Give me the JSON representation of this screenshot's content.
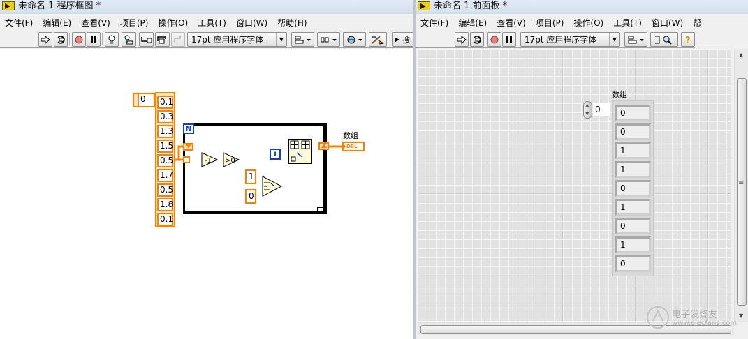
{
  "block_diagram": {
    "title": "未命名 1 程序框图 *",
    "menu": [
      "文件(F)",
      "编辑(E)",
      "查看(V)",
      "项目(P)",
      "操作(O)",
      "工具(T)",
      "窗口(W)",
      "帮助(H)"
    ],
    "toolbar": {
      "font": "17pt 应用程序字体",
      "search_label": "搜"
    },
    "array_index": "0",
    "array_constant": [
      "0.1",
      "0.3",
      "1.3",
      "1.5",
      "0.5",
      "1.7",
      "0.5",
      "1.8",
      "0.1"
    ],
    "loop_count_terminal": "N",
    "loop_iteration_terminal": "i",
    "true_constant": "1",
    "false_constant": "0",
    "decrement_label": "-1",
    "greater_zero_label": ">0",
    "indicator_label": "数组",
    "indicator_type": "DBL"
  },
  "front_panel": {
    "title": "未命名 1 前面板 *",
    "menu": [
      "文件(F)",
      "编辑(E)",
      "查看(V)",
      "项目(P)",
      "操作(O)",
      "工具(T)",
      "窗口(W)",
      "帮"
    ],
    "toolbar": {
      "font": "17pt 应用程序字体"
    },
    "array_label": "数组",
    "array_index": "0",
    "array_values": [
      "0",
      "0",
      "1",
      "1",
      "0",
      "1",
      "0",
      "1",
      "0"
    ]
  },
  "watermark": {
    "text": "电子发烧友",
    "url": "www.elecfans.com"
  }
}
